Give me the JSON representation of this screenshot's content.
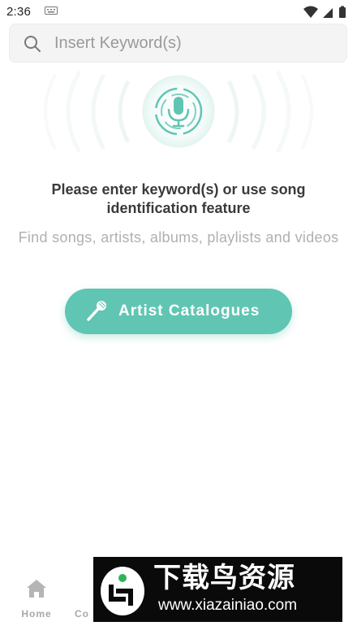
{
  "status_bar": {
    "time": "2:36",
    "icons": [
      "keyboard-icon",
      "wifi-icon",
      "signal-icon",
      "battery-icon"
    ]
  },
  "search": {
    "placeholder": "Insert Keyword(s)",
    "value": "",
    "icon": "search-icon"
  },
  "identify": {
    "icon": "microphone-icon"
  },
  "message": {
    "title": "Please enter keyword(s) or use song identification feature",
    "subtitle": "Find songs, artists, albums, playlists and videos"
  },
  "artist_button": {
    "label": "Artist Catalogues",
    "icon": "microphone-icon"
  },
  "bottom_nav": {
    "items": [
      {
        "label": "Home",
        "icon": "home-icon"
      },
      {
        "label": "Co",
        "icon": ""
      }
    ]
  },
  "watermark": {
    "title": "下载鸟资源",
    "url": "www.xiazainiao.com"
  },
  "colors": {
    "accent": "#61c5b3",
    "background": "#ffffff",
    "search_bg": "#f4f4f4",
    "subtext": "#b0b0b0",
    "title_text": "#3a3a3a"
  }
}
